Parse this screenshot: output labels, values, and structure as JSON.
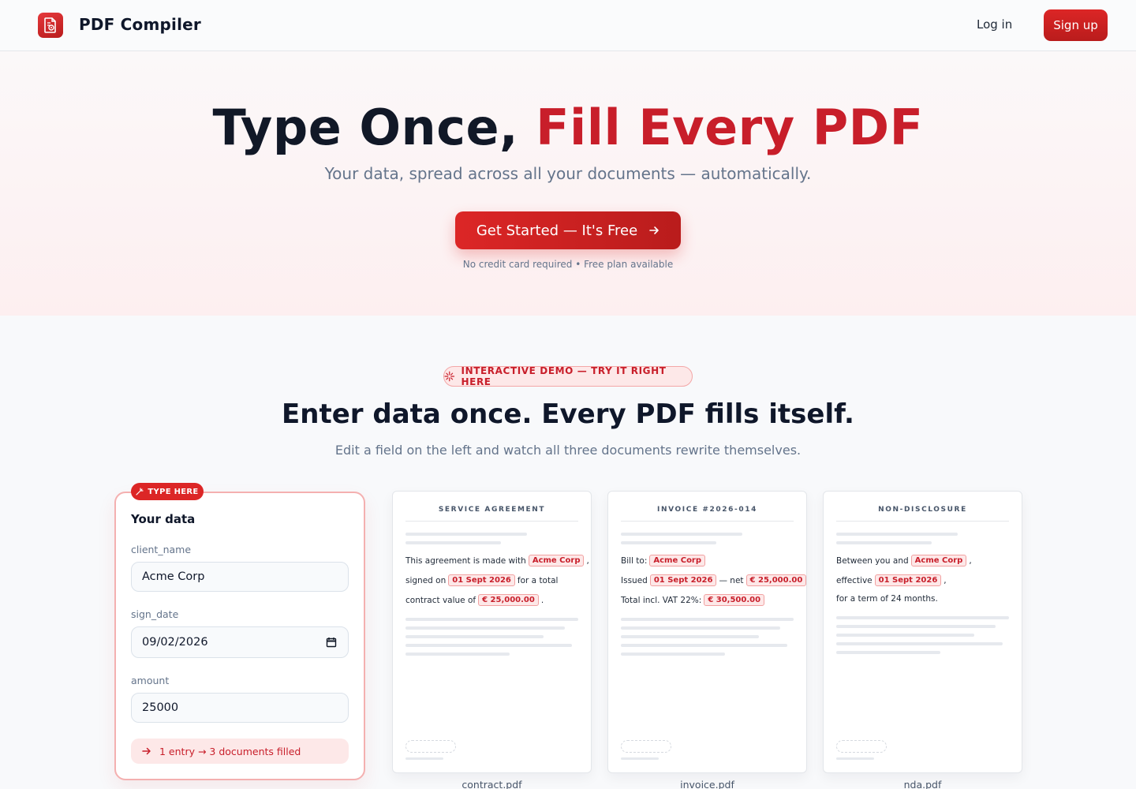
{
  "nav": {
    "brand": "PDF Compiler",
    "login_label": "Log in",
    "signup_label": "Sign up",
    "accent_color": "#dc2626"
  },
  "hero": {
    "title_part1": "Type Once, ",
    "title_part2": "Fill Every PDF",
    "subtitle": "Your data, spread across all your documents — automatically.",
    "cta_label": "Get Started — It's Free",
    "cta_icon": "arrow-right-icon",
    "note": "No credit card required • Free plan available"
  },
  "demo": {
    "badge": "INTERACTIVE DEMO — TRY IT RIGHT HERE",
    "title": "Enter data once. Every PDF fills itself.",
    "subtitle": "Edit a field on the left and watch all three documents rewrite themselves.",
    "form": {
      "tag": "TYPE HERE",
      "heading": "Your data",
      "fields": [
        {
          "label": "client_name",
          "value": "Acme Corp"
        },
        {
          "label": "sign_date",
          "value": "09/02/2026"
        },
        {
          "label": "amount",
          "value": "25000"
        }
      ],
      "result": "1 entry → 3 documents filled"
    },
    "docs": [
      {
        "header": "SERVICE AGREEMENT",
        "file": "contract.pdf",
        "lines": [
          [
            "This agreement is made with",
            "Acme Corp",
            ","
          ],
          [
            "signed on",
            "01 Sept 2026",
            "for a total"
          ],
          [
            "contract value of",
            "€ 25,000.00",
            "."
          ]
        ]
      },
      {
        "header": "INVOICE #2026-014",
        "file": "invoice.pdf",
        "lines": [
          [
            "Bill to:",
            "Acme Corp",
            ""
          ],
          [
            "Issued",
            "01 Sept 2026",
            "— net",
            "€ 25,000.00"
          ],
          [
            "Total incl. VAT 22%:",
            "€ 30,500.00",
            ""
          ]
        ]
      },
      {
        "header": "NON-DISCLOSURE",
        "file": "nda.pdf",
        "lines": [
          [
            "Between you and",
            "Acme Corp",
            ","
          ],
          [
            "effective",
            "01 Sept 2026",
            ","
          ],
          [
            "for a term of 24 months.",
            "",
            ""
          ]
        ]
      }
    ]
  }
}
